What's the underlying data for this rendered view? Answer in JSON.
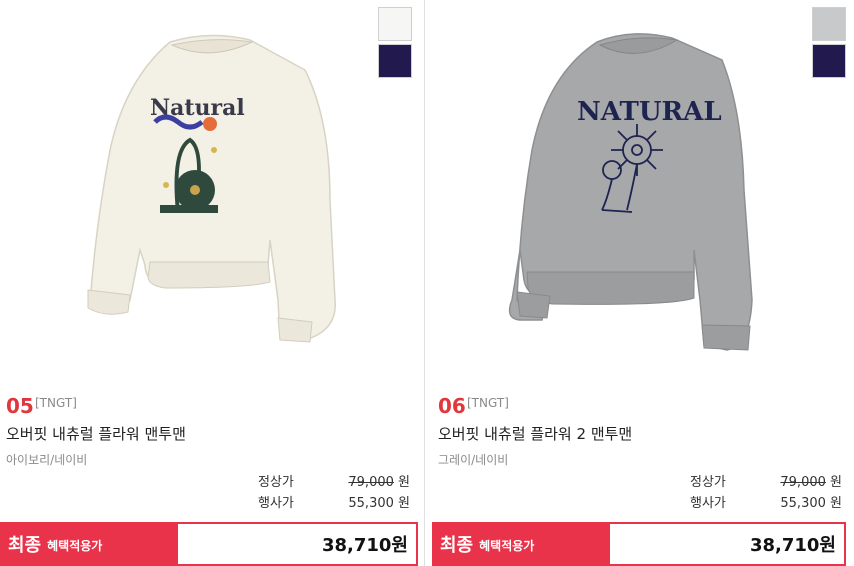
{
  "products": [
    {
      "number": "05",
      "brand": "[TNGT]",
      "name": "오버핏 내츄럴 플라워 맨투맨",
      "color": "아이보리/네이비",
      "regular_label": "정상가",
      "regular_price": "79,000",
      "event_label": "행사가",
      "event_price": "55,300",
      "won": "원",
      "final_title": "최종",
      "final_sub": "혜택적용가",
      "final_price": "38,710원",
      "print_text": "Natural",
      "swatches": [
        "#f6f6f4",
        "#221a4f"
      ],
      "garment_color": "#f3f0e6"
    },
    {
      "number": "06",
      "brand": "[TNGT]",
      "name": "오버핏 내츄럴 플라워 2 맨투맨",
      "color": "그레이/네이비",
      "regular_label": "정상가",
      "regular_price": "79,000",
      "event_label": "행사가",
      "event_price": "55,300",
      "won": "원",
      "final_title": "최종",
      "final_sub": "혜택적용가",
      "final_price": "38,710원",
      "print_text": "NATURAL",
      "swatches": [
        "#c8c9cb",
        "#221a4f"
      ],
      "garment_color": "#a7a8aa"
    }
  ]
}
